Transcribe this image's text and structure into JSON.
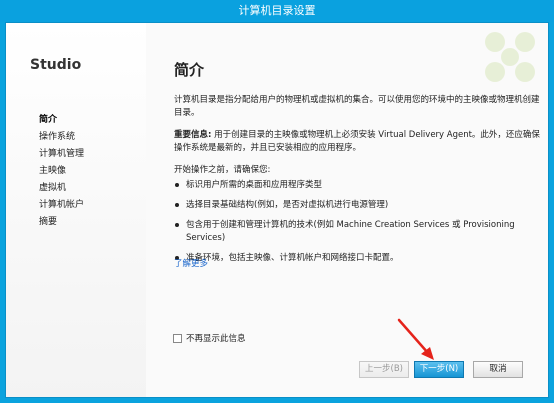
{
  "window": {
    "title": "计算机目录设置"
  },
  "sidebar": {
    "brand": "Studio",
    "items": [
      {
        "label": "简介"
      },
      {
        "label": "操作系统"
      },
      {
        "label": "计算机管理"
      },
      {
        "label": "主映像"
      },
      {
        "label": "虚拟机"
      },
      {
        "label": "计算机帐户"
      },
      {
        "label": "摘要"
      }
    ]
  },
  "main": {
    "heading": "简介",
    "para1": "计算机目录是指分配给用户的物理机或虚拟机的集合。可以使用您的环境中的主映像或物理机创建目录。",
    "para2_label": "重要信息:",
    "para2_text": " 用于创建目录的主映像或物理机上必须安装 Virtual Delivery Agent。此外，还应确保操作系统是最新的，并且已安装相应的应用程序。",
    "intro": "开始操作之前，请确保您:",
    "bullets": [
      "标识用户所需的桌面和应用程序类型",
      "选择目录基础结构(例如，是否对虚拟机进行电源管理)",
      "包含用于创建和管理计算机的技术(例如 Machine Creation Services 或 Provisioning Services)",
      "准备环境，包括主映像、计算机帐户和网络接口卡配置。"
    ],
    "learn_more": "了解更多",
    "dont_show": "不再显示此信息"
  },
  "buttons": {
    "back": "上一步(B)",
    "next": "下一步(N)",
    "cancel": "取消"
  },
  "colors": {
    "accent": "#0aa1df",
    "arrow": "#e5231b"
  }
}
